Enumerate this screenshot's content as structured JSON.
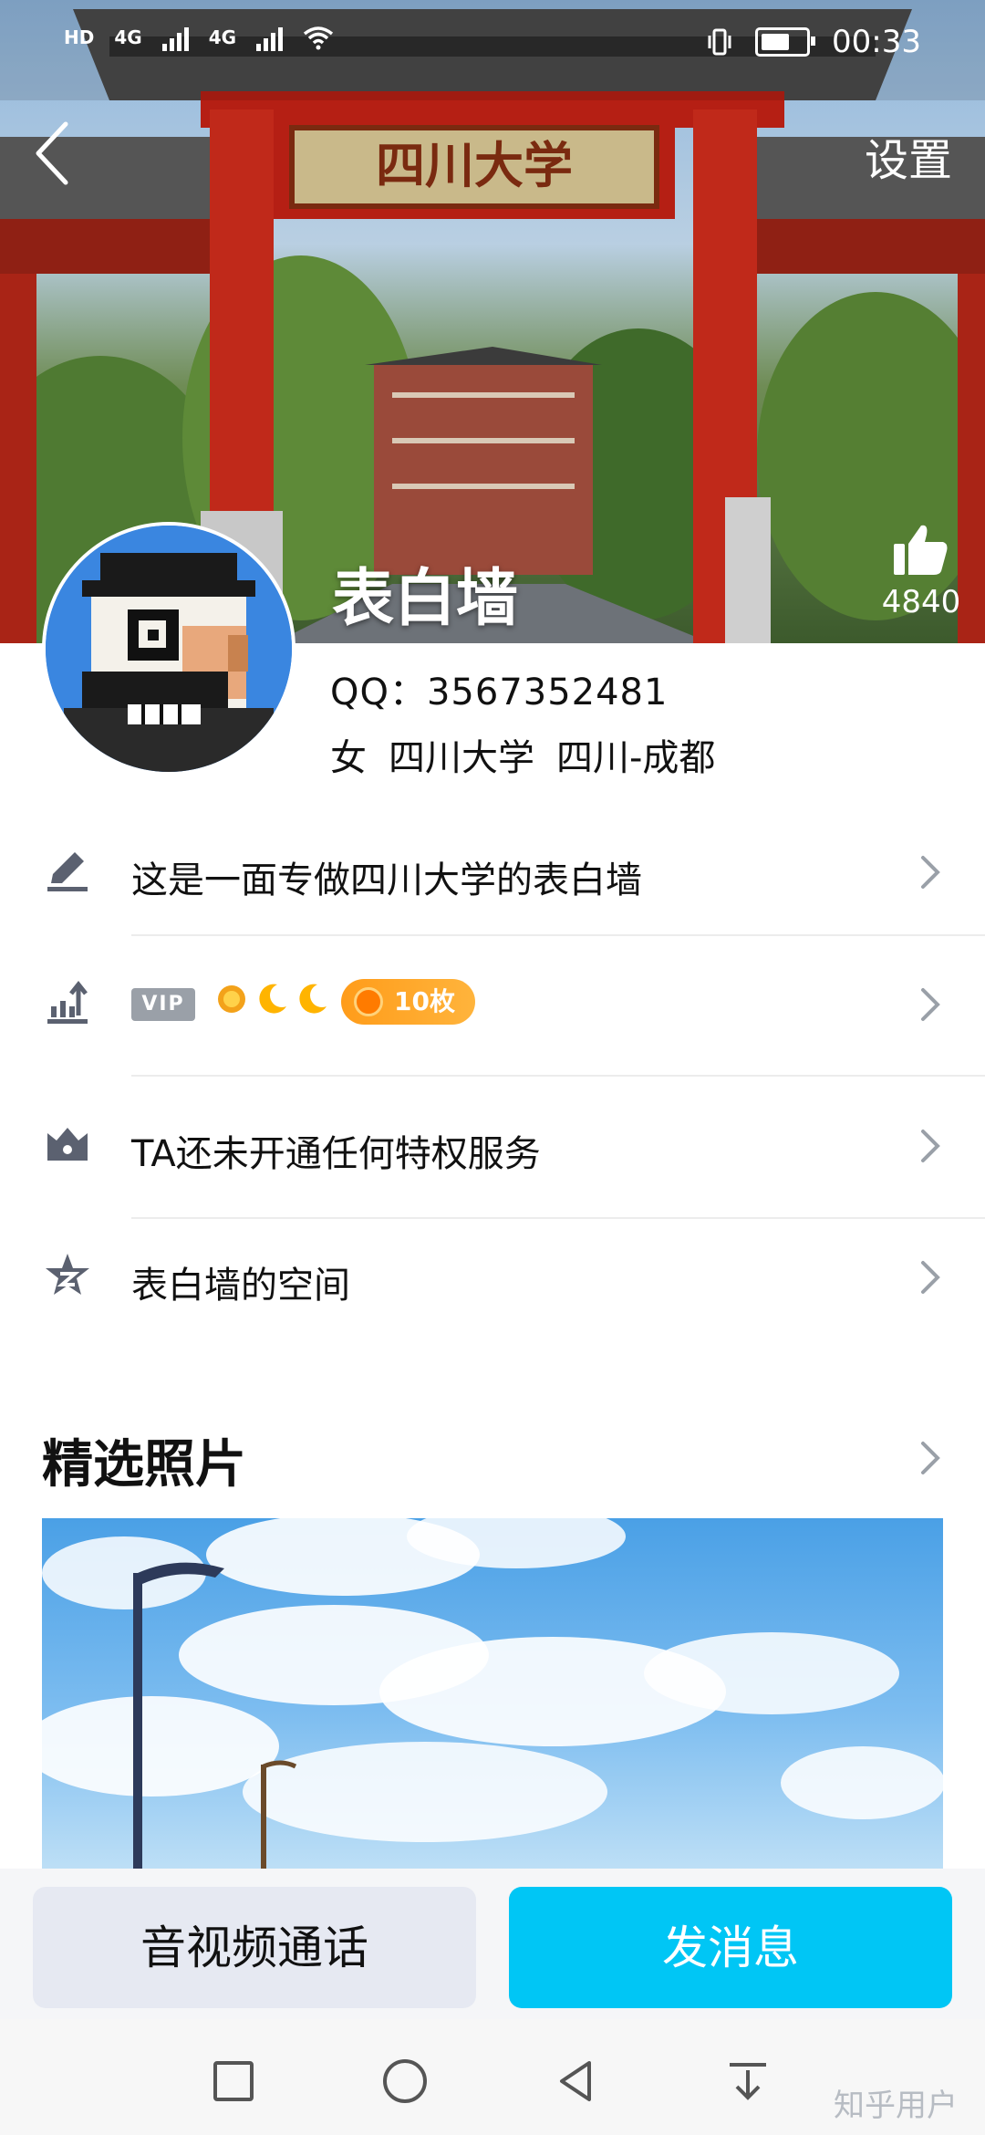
{
  "status_bar": {
    "network_left": "HD",
    "net1": "4G",
    "net2": "4G",
    "time": "00:33"
  },
  "header": {
    "back_icon": "chevron-left-icon",
    "settings_label": "设置",
    "nickname": "表白墙",
    "likes": "4840",
    "cover_sign_text": "四川大学"
  },
  "profile": {
    "qq": "QQ：3567352481",
    "gender": "女",
    "school": "四川大学",
    "location": "四川-成都"
  },
  "rows": [
    {
      "icon": "pencil-icon",
      "label": "这是一面专做四川大学的表白墙"
    },
    {
      "icon": "level-up-icon",
      "vip_badge": "VIP",
      "coins": "10枚"
    },
    {
      "icon": "crown-icon",
      "label": "TA还未开通任何特权服务"
    },
    {
      "icon": "star-space-icon",
      "label": "表白墙的空间"
    }
  ],
  "photos": {
    "title": "精选照片"
  },
  "actions": {
    "call_label": "音视频通话",
    "message_label": "发消息"
  },
  "watermark": "知乎用户",
  "colors": {
    "accent": "#00c6f5",
    "coin": "#ff9c1a",
    "secondary_button": "#e6e9f2"
  }
}
